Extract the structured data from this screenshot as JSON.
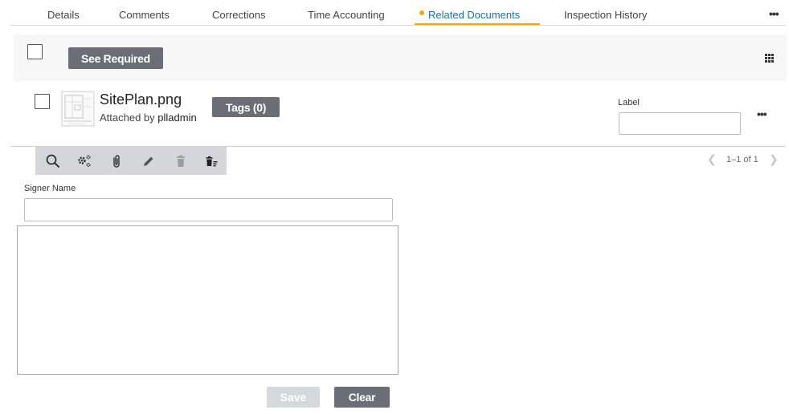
{
  "tabs": [
    {
      "label": "Details"
    },
    {
      "label": "Comments"
    },
    {
      "label": "Corrections"
    },
    {
      "label": "Time Accounting"
    },
    {
      "label": "Related Documents",
      "active": true
    },
    {
      "label": "Inspection History"
    }
  ],
  "tabs_more_label": "•••",
  "header": {
    "see_required_label": "See Required"
  },
  "document": {
    "name": "SitePlan.png",
    "attached_prefix": "Attached by",
    "attached_user": "plladmin",
    "tags_label": "Tags (0)",
    "label_caption": "Label",
    "label_value": "",
    "more_label": "•••"
  },
  "toolbar": {
    "icons": [
      "search-icon",
      "settings-gears-icon",
      "paperclip-icon",
      "pencil-icon",
      "trash-icon",
      "delete-list-icon"
    ]
  },
  "pagination": {
    "text": "1–1 of 1"
  },
  "signer": {
    "label": "Signer Name",
    "value": ""
  },
  "actions": {
    "save_label": "Save",
    "clear_label": "Clear"
  },
  "colors": {
    "accent": "#f2a900",
    "active_tab": "#1a6fb0",
    "button_dark": "#6b6e77",
    "button_disabled": "#d7d8dc",
    "toolbar_bg": "#d5d6da"
  }
}
